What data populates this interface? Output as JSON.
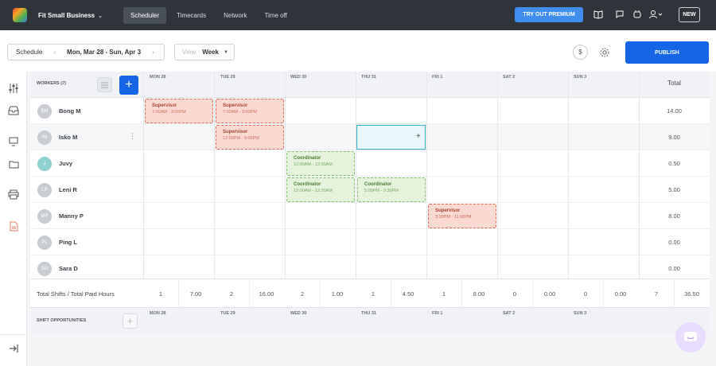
{
  "topbar": {
    "company": "Fit Small Business",
    "tabs": [
      "Scheduler",
      "Timecards",
      "Network",
      "Time off"
    ],
    "premium": "TRY OUT PREMIUM",
    "new_label": "NEW"
  },
  "toolbar": {
    "schedule_label": "Schedule",
    "date_range": "Mon, Mar 28 - Sun, Apr 3",
    "view_label": "View",
    "view_value": "Week",
    "publish": "PUBLISH"
  },
  "grid": {
    "workers_header": "WORKERS (7)",
    "days": [
      "MON 28",
      "TUE 29",
      "WED 30",
      "THU 31",
      "FRI 1",
      "SAT 2",
      "SUN 3"
    ],
    "total_header": "Total",
    "workers": [
      {
        "initials": "BM",
        "name": "Bong M",
        "total": "14.00"
      },
      {
        "initials": "IM",
        "name": "Isko M",
        "total": "9.00"
      },
      {
        "initials": "J",
        "name": "Juvy",
        "total": "0.50"
      },
      {
        "initials": "LR",
        "name": "Leni R",
        "total": "5.00"
      },
      {
        "initials": "MP",
        "name": "Manny P",
        "total": "8.00"
      },
      {
        "initials": "PL",
        "name": "Ping L",
        "total": "0.00"
      },
      {
        "initials": "SD",
        "name": "Sara D",
        "total": "0.00"
      }
    ],
    "shifts": [
      {
        "role": "Supervisor",
        "time": "7:00AM - 3:00PM"
      },
      {
        "role": "Supervisor",
        "time": "7:00AM - 3:00PM"
      },
      {
        "role": "Supervisor",
        "time": "12:00PM - 9:00PM"
      },
      {
        "role": "Coordinator",
        "time": "12:00AM - 12:30AM"
      },
      {
        "role": "Coordinator",
        "time": "12:00AM - 12:30AM"
      },
      {
        "role": "Coordinator",
        "time": "5:00PM - 9:30PM"
      },
      {
        "role": "Supervisor",
        "time": "3:00PM - 11:00PM"
      }
    ],
    "totals_label": "Total Shifts / Total Paid Hours",
    "totals": [
      {
        "shifts": "1",
        "hours": "7.00"
      },
      {
        "shifts": "2",
        "hours": "16.00"
      },
      {
        "shifts": "2",
        "hours": "1.00"
      },
      {
        "shifts": "1",
        "hours": "4.50"
      },
      {
        "shifts": "1",
        "hours": "8.00"
      },
      {
        "shifts": "0",
        "hours": "0.00"
      },
      {
        "shifts": "0",
        "hours": "0.00"
      },
      {
        "shifts": "7",
        "hours": "36.50"
      }
    ],
    "opportunities_label": "SHIFT OPPORTUNITIES"
  },
  "colors": {
    "topbar": "#2f343b",
    "accent": "#1565e6",
    "shift_red": "#fbd9d3",
    "shift_green": "#e5f3dc"
  }
}
